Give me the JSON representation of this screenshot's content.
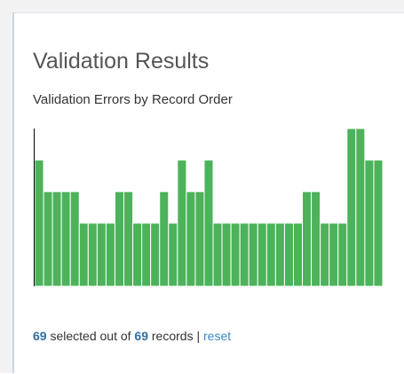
{
  "card": {
    "title": "Validation Results"
  },
  "chart_data": {
    "type": "bar",
    "title": "Validation Errors by Record Order",
    "xlabel": "",
    "ylabel": "",
    "values": [
      4,
      3,
      3,
      3,
      3,
      2,
      2,
      2,
      2,
      3,
      3,
      2,
      2,
      2,
      3,
      2,
      4,
      3,
      3,
      4,
      2,
      2,
      2,
      2,
      2,
      2,
      2,
      2,
      2,
      2,
      3,
      3,
      2,
      2,
      2,
      5,
      5,
      4,
      4
    ],
    "ylim": [
      0,
      5
    ],
    "bar_color": "#4cb35a",
    "bar_border": "#ffffff",
    "grid": false,
    "legend": "none"
  },
  "footer": {
    "selected_count": "69",
    "text_middle": " selected out of ",
    "total_count": "69",
    "text_after": " records | ",
    "reset_label": "reset"
  }
}
